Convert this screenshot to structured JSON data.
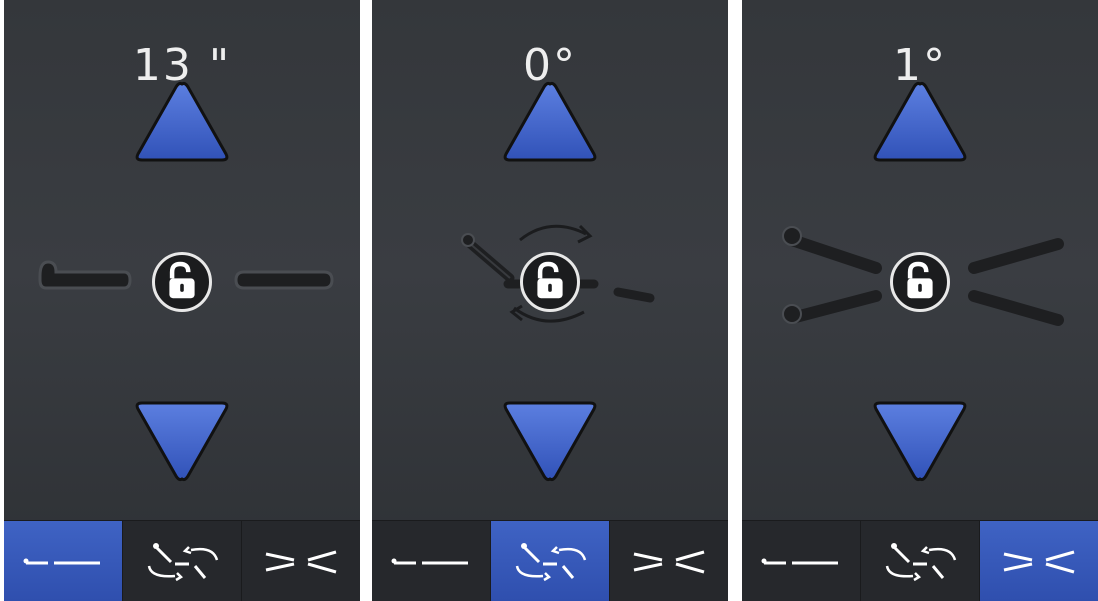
{
  "colors": {
    "accent": "#3a5fc8",
    "panel_bg": "#36393d",
    "tab_bar_bg": "#26282c",
    "text": "#eeeeee"
  },
  "panels": [
    {
      "value": "13 \"",
      "mode": "height",
      "up_icon": "triangle-up-icon",
      "down_icon": "triangle-down-icon",
      "lock_icon": "unlocked-padlock-icon",
      "active_tab": 0
    },
    {
      "value": "0°",
      "mode": "rotation",
      "up_icon": "triangle-up-icon",
      "down_icon": "triangle-down-icon",
      "lock_icon": "unlocked-padlock-icon",
      "active_tab": 1
    },
    {
      "value": "1°",
      "mode": "angle",
      "up_icon": "triangle-up-icon",
      "down_icon": "triangle-down-icon",
      "lock_icon": "unlocked-padlock-icon",
      "active_tab": 2
    }
  ],
  "tabs": [
    {
      "name": "flat-mode-tab",
      "icon": "flat-line-icon"
    },
    {
      "name": "rotate-mode-tab",
      "icon": "rotate-arrows-icon"
    },
    {
      "name": "angle-mode-tab",
      "icon": "converging-lines-icon"
    }
  ]
}
